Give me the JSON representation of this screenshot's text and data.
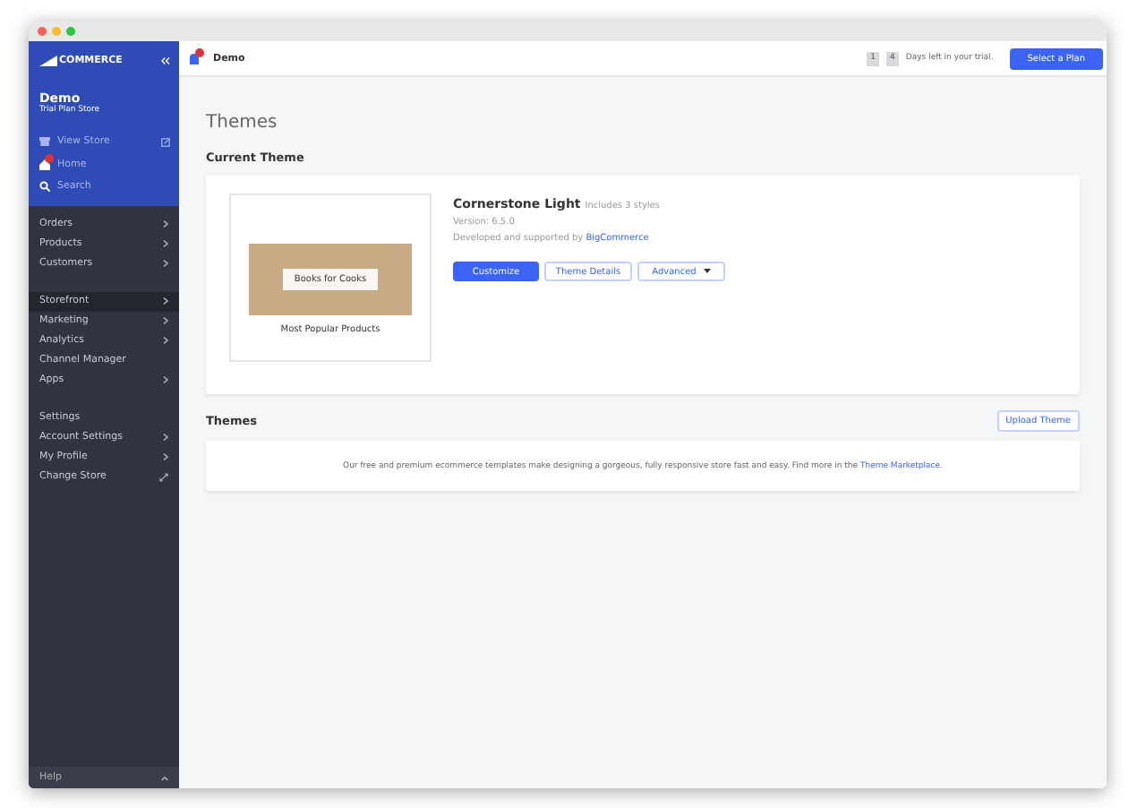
{
  "sidebar": {
    "brand": "COMMERCE",
    "store_name": "Demo",
    "plan": "Trial Plan Store",
    "quick_links": [
      {
        "label": "View Store",
        "kind": "store"
      },
      {
        "label": "Home",
        "kind": "home"
      },
      {
        "label": "Search",
        "kind": "search"
      }
    ],
    "groups": [
      [
        {
          "label": "Orders",
          "kind": "chevron",
          "selected": false
        },
        {
          "label": "Products",
          "kind": "chevron",
          "selected": false
        },
        {
          "label": "Customers",
          "kind": "chevron",
          "selected": false
        }
      ],
      [
        {
          "label": "Storefront",
          "kind": "chevron",
          "selected": true
        },
        {
          "label": "Marketing",
          "kind": "chevron",
          "selected": false
        },
        {
          "label": "Analytics",
          "kind": "chevron",
          "selected": false
        },
        {
          "label": "Channel Manager",
          "kind": "plain",
          "selected": false
        },
        {
          "label": "Apps",
          "kind": "chevron",
          "selected": false
        }
      ],
      [
        {
          "label": "Settings",
          "kind": "plain",
          "selected": false
        },
        {
          "label": "Account Settings",
          "kind": "chevron",
          "selected": false
        },
        {
          "label": "My Profile",
          "kind": "chevron",
          "selected": false
        },
        {
          "label": "Change Store",
          "kind": "swap",
          "selected": false
        }
      ]
    ],
    "footer": "Help"
  },
  "topbar": {
    "store": "Demo",
    "days_digits": [
      "1",
      "4"
    ],
    "days_text": "Days left in your trial.",
    "plan_button": "Select a Plan"
  },
  "page_title": "Themes",
  "current_theme": {
    "heading": "Current Theme",
    "name": "Cornerstone Light",
    "styles": "Includes 3 styles",
    "version": "Version: 6.5.0",
    "developer_text": "Developed and supported by ",
    "developer_link": "BigCommerce",
    "preview": {
      "hero": "Books for Cooks",
      "section": "Most Popular Products"
    },
    "buttons": [
      {
        "label": "Customize",
        "kind": "primary"
      },
      {
        "label": "Theme Details",
        "kind": "secondary"
      },
      {
        "label": "Advanced",
        "kind": "dropdown"
      }
    ]
  },
  "themes": {
    "heading": "Themes",
    "upload_button": "Upload Theme",
    "text": "Our free and premium ecommerce templates make designing a gorgeous, fully responsive store fast and easy. Find more in the ",
    "link": "Theme Marketplace",
    "after": "."
  }
}
